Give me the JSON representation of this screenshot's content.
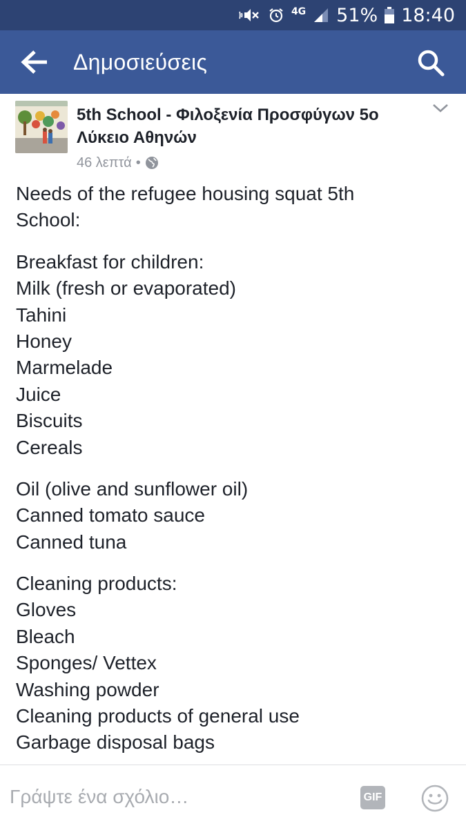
{
  "status_bar": {
    "battery": "51%",
    "time": "18:40",
    "network": "4G"
  },
  "nav": {
    "title": "Δημοσιεύσεις"
  },
  "post": {
    "author": "5th School - Φιλοξενία Προσφύγων 5ο Λύκειο Αθηνών",
    "time": "46 λεπτά",
    "separator": "•",
    "paragraphs": [
      [
        "Needs of the refugee housing squat 5th",
        "School:"
      ],
      [
        "Breakfast for children:",
        "Milk (fresh or evaporated)",
        "Tahini",
        "Honey",
        "Marmelade",
        "Juice",
        "Biscuits",
        "Cereals"
      ],
      [
        "Oil (olive and sunflower oil)",
        "Canned tomato sauce",
        "Canned tuna"
      ],
      [
        "Cleaning products:",
        "Gloves",
        "Bleach",
        "Sponges/ Vettex",
        "Washing powder",
        "Cleaning products of general use",
        "Garbage disposal bags"
      ]
    ]
  },
  "comment": {
    "placeholder": "Γράψτε ένα σχόλιο…",
    "gif_label": "GIF"
  },
  "colors": {
    "status_bar": "#2d4373",
    "nav_bar": "#3b5998",
    "text": "#1d2129",
    "meta": "#90949c"
  },
  "icons": [
    "back-arrow-icon",
    "search-icon",
    "chevron-down-icon",
    "globe-icon",
    "emoji-icon",
    "mute-icon",
    "alarm-icon",
    "signal-icon",
    "battery-icon"
  ]
}
